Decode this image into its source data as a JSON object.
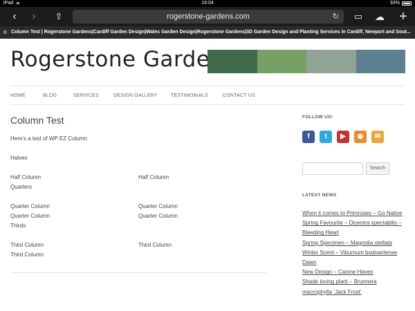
{
  "status_bar": {
    "carrier": "iPad",
    "wifi": "≋",
    "time": "19:04",
    "battery": "93%"
  },
  "browser": {
    "url": "rogerstone-gardens.com",
    "tab_title": "Column Test | Rogerstone Gardens|Cardiff Garden Design|Wales Garden Design|Rogerstone Gardens|3D Garden Design and Planting Services in Cardiff, Newport and Sout..."
  },
  "site": {
    "logo": "Rogerstone Gardens",
    "swatch_colors": [
      "#3f6b4a",
      "#76a165",
      "#8fa495",
      "#5b8190"
    ]
  },
  "nav": {
    "items": [
      {
        "label": "HOME"
      },
      {
        "label": "BLOG"
      },
      {
        "label": "SERVICES"
      },
      {
        "label": "DESIGN GALLERY"
      },
      {
        "label": "TESTIMONIALS"
      },
      {
        "label": "CONTACT US"
      }
    ]
  },
  "post": {
    "title": "Column Test",
    "intro": "Here’s a test of WP EZ Column",
    "halves_label": "Halves",
    "half_left": "Half Column",
    "half_right": "Half Column",
    "quarters_label": "Quarters",
    "quarter_left_1": "Quarter Column",
    "quarter_left_2": "Quarter Column",
    "quarter_right_1": "Quarter Column",
    "quarter_right_2": "Quarter Column",
    "thirds_label": "Thirds",
    "third_left_1": "Third Column",
    "third_left_2": "Third Column",
    "third_right_1": "Third Column"
  },
  "sidebar": {
    "follow_title": "FOLLOW US!",
    "social": [
      {
        "name": "facebook-icon",
        "glyph": "f",
        "color": "#3b5998"
      },
      {
        "name": "twitter-icon",
        "glyph": "t",
        "color": "#2fa8e0"
      },
      {
        "name": "youtube-icon",
        "glyph": "▶",
        "color": "#c4302b"
      },
      {
        "name": "rss-icon",
        "glyph": "◉",
        "color": "#f08a24"
      },
      {
        "name": "email-icon",
        "glyph": "✉",
        "color": "#e8a73a"
      }
    ],
    "search_placeholder": "",
    "search_button": "Search",
    "news_title": "LATEST NEWS",
    "news": [
      "When it comes to Primroses – Go Native",
      "Spring Favourite – Dicentra spectabilis – Bleeding Heart",
      "Spring Specimen – Magnolia stellata",
      "Winter Scent – Viburnum bodnantense Dawn",
      "New Design – Canine Haven",
      "Shade loving plant – Brunnera macrophylla ‘Jack Frost’"
    ]
  }
}
